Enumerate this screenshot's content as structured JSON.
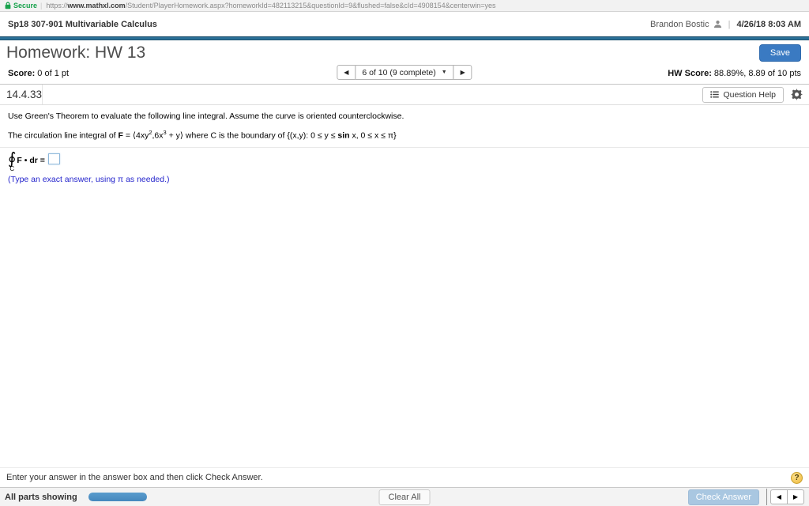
{
  "colors": {
    "accent_bar": "#2b7097",
    "save_button": "#3a7ac2",
    "check_answer_button": "#a9c7e1",
    "progress_fill": "#4587bd",
    "secure_green": "#18a24c",
    "answer_note_blue": "#2424cc",
    "answer_box_border": "#8db7da",
    "help_icon_yellow": "#efba3e"
  },
  "icons": {
    "lock-icon": "padlock (green)",
    "user-icon": "person silhouette",
    "list-icon": "bulleted list",
    "gear-icon": "gear",
    "help-icon": "?",
    "prev-icon": "◀",
    "next-icon": "▶",
    "caret-down-icon": "▼",
    "oint-symbol": "∮"
  },
  "browser": {
    "secure_label": "Secure",
    "url_prefix": "https://",
    "url_domain": "www.mathxl.com",
    "url_path": "/Student/PlayerHomework.aspx?homeworkId=482113215&questionId=9&flushed=false&cId=4908154&centerwin=yes"
  },
  "header": {
    "course": "Sp18 307-901 Multivariable Calculus",
    "user": "Brandon Bostic",
    "separator": "|",
    "datetime": "4/26/18 8:03 AM"
  },
  "title_bar": {
    "title": "Homework: HW 13",
    "save_label": "Save"
  },
  "score_bar": {
    "score_label": "Score:",
    "score_value": " 0 of 1 pt",
    "nav_prev": "◀",
    "nav_selector": "6 of 10 (9 complete)",
    "nav_caret": "▼",
    "nav_next": "▶",
    "hw_score_label": "HW Score:",
    "hw_score_value": " 88.89%, 8.89 of 10 pts"
  },
  "question_bar": {
    "number": "14.4.33",
    "help_label": "Question Help"
  },
  "question": {
    "line1": "Use Green's Theorem to evaluate the following line integral. Assume the curve is oriented counterclockwise.",
    "line2": {
      "prefix": "The circulation line integral of ",
      "f": "F",
      "eq": " = ",
      "vec_open": "⟨4xy",
      "exp1": "2",
      "vec_mid": ",6x",
      "exp2": "3",
      "vec_close": " + y⟩",
      "where": " where C is the boundary of {(x,y): 0 ≤ y ≤ ",
      "sin": "sin",
      "domain": " x, 0 ≤ x ≤ π}"
    },
    "answer": {
      "integral": "∮",
      "sub": "C",
      "integrand_f": "F",
      "integrand_rest": " • dr = ",
      "input_value": "",
      "note": "(Type an exact answer, using π as needed.)"
    }
  },
  "hint": "Enter your answer in the answer box and then click Check Answer.",
  "help_icon_label": "?",
  "footer": {
    "status": "All parts showing",
    "progress_fill_percent": 100,
    "clear_label": "Clear All",
    "check_label": "Check Answer",
    "prev": "◀",
    "next": "▶"
  }
}
